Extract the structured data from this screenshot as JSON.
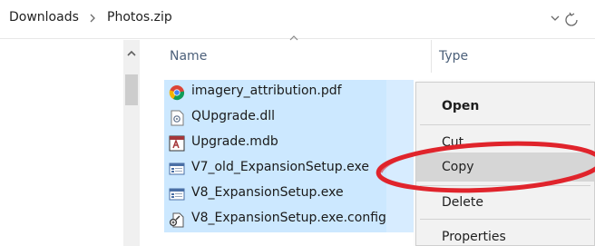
{
  "address_bar": {
    "crumbs": [
      "Downloads",
      "Photos.zip"
    ],
    "separator_icon": "chevron-right-icon",
    "dropdown_icon": "chevron-down-icon",
    "refresh_icon": "refresh-icon"
  },
  "columns": {
    "name": "Name",
    "type": "Type",
    "sort_icon": "sort-up-icon"
  },
  "files": [
    {
      "name": "imagery_attribution.pdf",
      "icon": "chrome-pdf-icon"
    },
    {
      "name": "QUpgrade.dll",
      "icon": "dll-file-icon"
    },
    {
      "name": "Upgrade.mdb",
      "icon": "access-db-icon"
    },
    {
      "name": "V7_old_ExpansionSetup.exe",
      "icon": "exe-file-icon"
    },
    {
      "name": "V8_ExpansionSetup.exe",
      "icon": "exe-file-icon"
    },
    {
      "name": "V8_ExpansionSetup.exe.config",
      "icon": "config-file-icon"
    }
  ],
  "context_menu": {
    "items": [
      {
        "label": "Open",
        "bold": true
      },
      {
        "label": "Cut"
      },
      {
        "label": "Copy",
        "highlighted": true
      },
      {
        "label": "Delete"
      },
      {
        "label": "Properties"
      }
    ]
  },
  "colors": {
    "selection": "#cce8ff",
    "annotation": "#e0242c",
    "menu_bg": "#f2f2f2",
    "menu_hover": "#d6d6d6"
  },
  "annotation": {
    "shape": "ellipse",
    "target": "Copy"
  }
}
